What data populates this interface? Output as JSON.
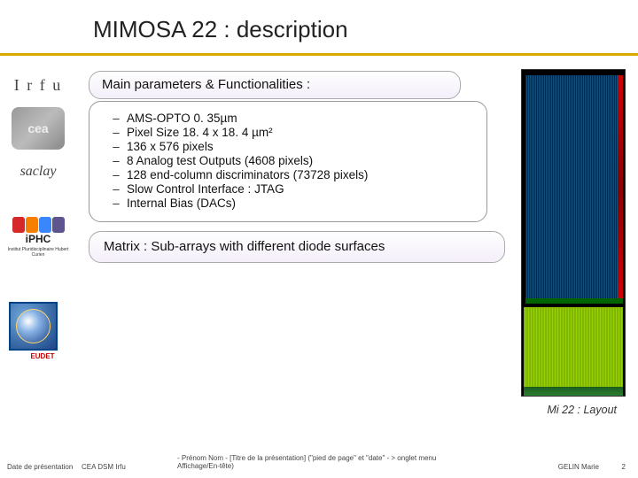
{
  "title": "MIMOSA 22 : description",
  "header_label": "Main parameters & Functionalities :",
  "params": [
    "AMS-OPTO 0. 35µm",
    "Pixel Size  18. 4 x 18. 4 µm²",
    "136 x 576 pixels",
    "8 Analog test Outputs (4608 pixels)",
    "128 end-column discriminators (73728 pixels)",
    "Slow Control Interface : JTAG",
    "Internal Bias (DACs)"
  ],
  "matrix_label": "Matrix :  Sub-arrays with different diode surfaces",
  "layout_caption": "Mi 22 : Layout",
  "logos": {
    "irfu": "I r f u",
    "cea": "cea",
    "saclay": "saclay",
    "iphc": "iPHC",
    "iphc_sub": "Institut Pluridisciplinaire Hubert Curien",
    "eudet": "EUDET"
  },
  "footer": {
    "date": "Date de présentation",
    "org": "CEA DSM Irfu",
    "mid": "- Prénom Nom -   [Titre de la présentation]      (\"pied de page\" et \"date\"  - > onglet menu Affichage/En-tête)",
    "author": "GELIN Marie",
    "page": "2"
  },
  "colors": {
    "gold": "#d6a800"
  }
}
